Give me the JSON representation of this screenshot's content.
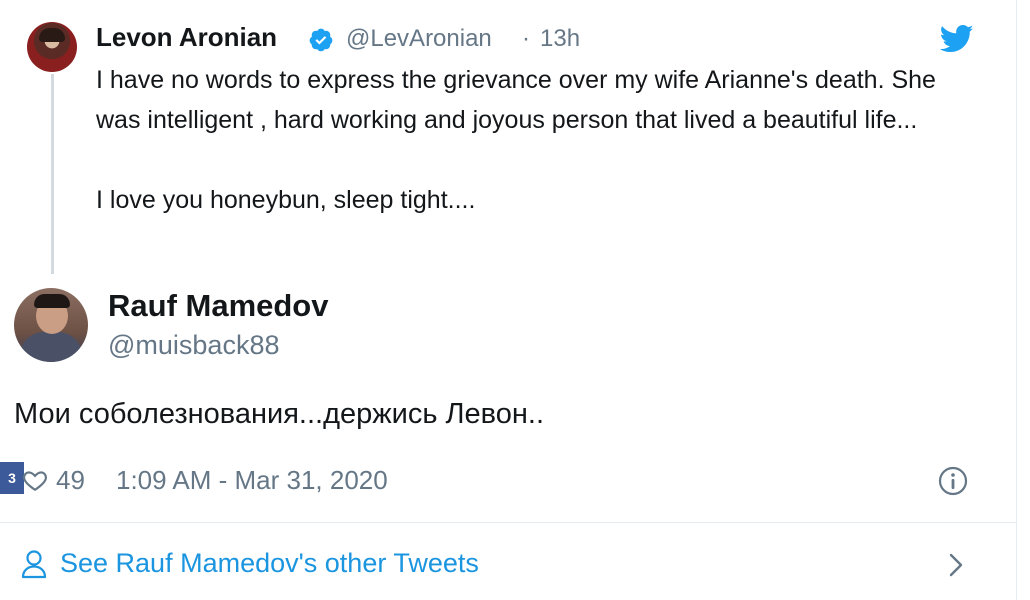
{
  "quoted_tweet": {
    "name": "Levon Aronian",
    "handle": "@LevAronian",
    "separator": "·",
    "time": "13h",
    "paragraph1": "I have no words to express the grievance over my wife Arianne's death. She was intelligent , hard working and joyous person that lived a  beautiful life...",
    "paragraph2": "I love you honeybun, sleep tight...."
  },
  "main_tweet": {
    "name": "Rauf Mamedov",
    "handle": "@muisback88",
    "text": "Мои соболезнования...держись Левон..",
    "likes": "49",
    "timestamp": "1:09 AM - Mar 31, 2020"
  },
  "overlay_badge": "3",
  "footer": {
    "link_label": "See Rauf Mamedov's other Tweets"
  },
  "icons": [
    "verified-icon",
    "twitter-bird-icon",
    "heart-icon",
    "info-icon",
    "person-icon",
    "chevron-right-icon"
  ],
  "colors": {
    "accent": "#1b95e0",
    "secondary_text": "#657786",
    "primary_text": "#14171a"
  }
}
